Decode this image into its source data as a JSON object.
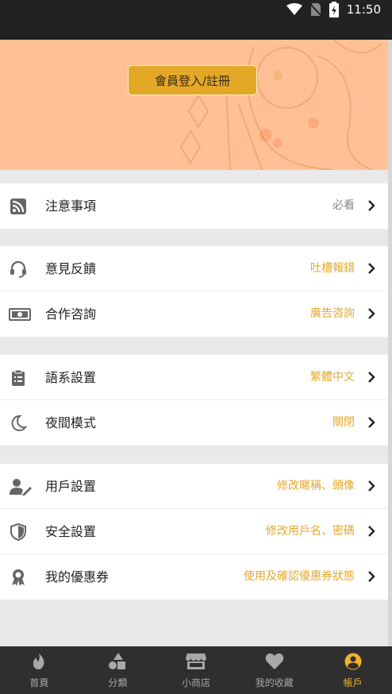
{
  "status_bar": {
    "time": "11:50"
  },
  "header": {
    "login_button": "會員登入/註冊"
  },
  "sections": [
    [
      {
        "key": "notice",
        "icon": "rss-icon",
        "label": "注意事項",
        "value": "必看",
        "value_style": "grey"
      }
    ],
    [
      {
        "key": "feedback",
        "icon": "headset-icon",
        "label": "意見反饋",
        "value": "吐槽報錯"
      },
      {
        "key": "cooperation",
        "icon": "money-icon",
        "label": "合作咨詢",
        "value": "廣告咨詢"
      }
    ],
    [
      {
        "key": "language",
        "icon": "clipboard-icon",
        "label": "語系設置",
        "value": "繁體中文"
      },
      {
        "key": "night",
        "icon": "moon-icon",
        "label": "夜間模式",
        "value": "關閉"
      }
    ],
    [
      {
        "key": "user-settings",
        "icon": "user-edit-icon",
        "label": "用戶設置",
        "value": "修改暱稱、頭像"
      },
      {
        "key": "security",
        "icon": "shield-icon",
        "label": "安全設置",
        "value": "修改用戶名、密碼"
      },
      {
        "key": "coupons",
        "icon": "award-icon",
        "label": "我的優惠券",
        "value": "使用及確認優惠券狀態"
      }
    ]
  ],
  "tabbar": [
    {
      "icon": "flame-icon",
      "label": "首頁"
    },
    {
      "icon": "shapes-icon",
      "label": "分類"
    },
    {
      "icon": "store-icon",
      "label": "小商店"
    },
    {
      "icon": "heart-icon",
      "label": "我的收藏"
    },
    {
      "icon": "user-circle-icon",
      "label": "帳戶",
      "active": true
    }
  ],
  "colors": {
    "accent": "#e5a82b",
    "banner": "#ffc096",
    "tabbar": "#2f2f2f"
  }
}
